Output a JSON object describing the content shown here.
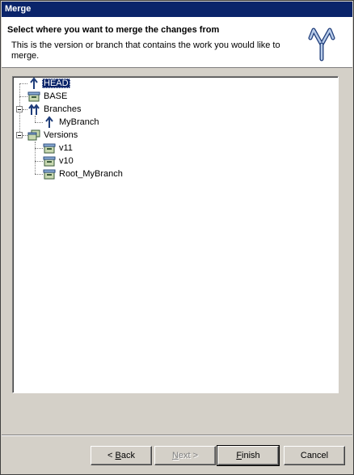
{
  "window": {
    "title": "Merge"
  },
  "header": {
    "title": "Select where you want to merge the changes from",
    "description": "This is the version or branch that contains the work you would like to merge.",
    "icon": "merge-arrows-icon"
  },
  "tree": {
    "nodes": [
      {
        "label": "HEAD",
        "icon": "branch-arrow-icon",
        "selected": true
      },
      {
        "label": "BASE",
        "icon": "version-box-icon"
      },
      {
        "label": "Branches",
        "icon": "branches-folder-icon",
        "expanded": true
      },
      {
        "label": "MyBranch",
        "icon": "branch-arrow-icon"
      },
      {
        "label": "Versions",
        "icon": "versions-folder-icon",
        "expanded": true
      },
      {
        "label": "v11",
        "icon": "version-box-icon"
      },
      {
        "label": "v10",
        "icon": "version-box-icon"
      },
      {
        "label": "Root_MyBranch",
        "icon": "version-box-icon"
      }
    ]
  },
  "buttons": {
    "back_pre": "< ",
    "back_acc": "B",
    "back_post": "ack",
    "next_acc": "N",
    "next_post": "ext >",
    "finish_acc": "F",
    "finish_post": "inish",
    "cancel": "Cancel"
  },
  "colors": {
    "titlebar": "#0a246a",
    "face": "#d4d0c8",
    "selection": "#0a246a"
  }
}
